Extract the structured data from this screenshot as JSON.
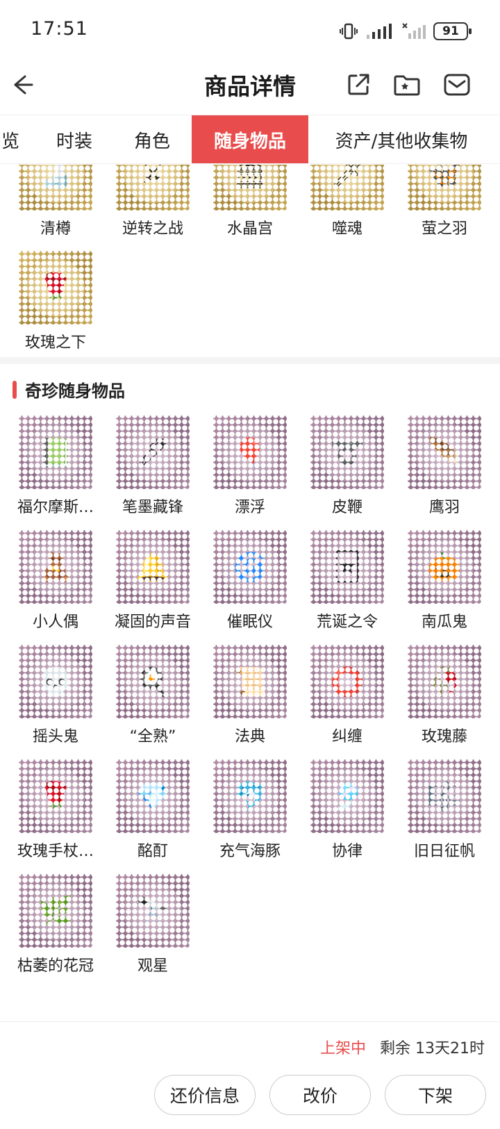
{
  "status_bar": {
    "time": "17:51",
    "battery": "91"
  },
  "header": {
    "title": "商品详情"
  },
  "tabs": [
    {
      "label": "览"
    },
    {
      "label": "时装"
    },
    {
      "label": "角色"
    },
    {
      "label": "随身物品"
    },
    {
      "label": "资产/其他收集物"
    }
  ],
  "gold_items": [
    {
      "label": "清樽"
    },
    {
      "label": "逆转之战"
    },
    {
      "label": "水晶宫"
    },
    {
      "label": "噬魂"
    },
    {
      "label": "萤之羽"
    },
    {
      "label": "玫瑰之下"
    }
  ],
  "section": {
    "title": "奇珍随身物品"
  },
  "rare_items": [
    {
      "label": "福尔摩斯…"
    },
    {
      "label": "笔墨藏锋"
    },
    {
      "label": "漂浮"
    },
    {
      "label": "皮鞭"
    },
    {
      "label": "鹰羽"
    },
    {
      "label": "小人偶"
    },
    {
      "label": "凝固的声音"
    },
    {
      "label": "催眠仪"
    },
    {
      "label": "荒诞之令"
    },
    {
      "label": "南瓜鬼"
    },
    {
      "label": "摇头鬼"
    },
    {
      "label": "“全熟”"
    },
    {
      "label": "法典"
    },
    {
      "label": "纠缠"
    },
    {
      "label": "玫瑰藤"
    },
    {
      "label": "玫瑰手杖…"
    },
    {
      "label": "酩酊"
    },
    {
      "label": "充气海豚"
    },
    {
      "label": "协律"
    },
    {
      "label": "旧日征帆"
    },
    {
      "label": "枯萎的花冠"
    },
    {
      "label": "观星"
    }
  ],
  "listing": {
    "status": "上架中",
    "remaining": "剩余 13天21时"
  },
  "buttons": {
    "bargain": "还价信息",
    "change_price": "改价",
    "delist": "下架"
  },
  "colors": {
    "accent": "#e84c4c"
  }
}
